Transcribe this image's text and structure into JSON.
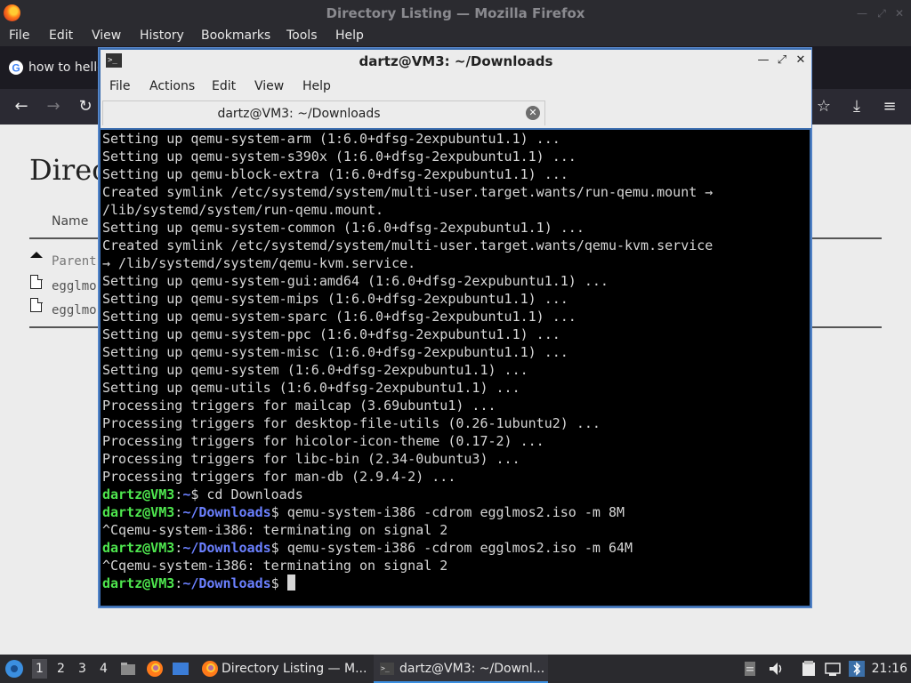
{
  "firefox": {
    "window_title": "Directory Listing — Mozilla Firefox",
    "menu": [
      "File",
      "Edit",
      "View",
      "History",
      "Bookmarks",
      "Tools",
      "Help"
    ],
    "tab_label": "how to hello",
    "page": {
      "heading": "Direc",
      "name_header": "Name",
      "parent_link": "Parent",
      "files": [
        "egglmo",
        "egglmo"
      ]
    }
  },
  "terminal": {
    "window_title": "dartz@VM3: ~/Downloads",
    "menu": [
      "File",
      "Actions",
      "Edit",
      "View",
      "Help"
    ],
    "tab_label": "dartz@VM3: ~/Downloads",
    "output_lines": [
      "Setting up qemu-system-arm (1:6.0+dfsg-2expubuntu1.1) ...",
      "Setting up qemu-system-s390x (1:6.0+dfsg-2expubuntu1.1) ...",
      "Setting up qemu-block-extra (1:6.0+dfsg-2expubuntu1.1) ...",
      "Created symlink /etc/systemd/system/multi-user.target.wants/run-qemu.mount →",
      "/lib/systemd/system/run-qemu.mount.",
      "Setting up qemu-system-common (1:6.0+dfsg-2expubuntu1.1) ...",
      "Created symlink /etc/systemd/system/multi-user.target.wants/qemu-kvm.service",
      "→ /lib/systemd/system/qemu-kvm.service.",
      "Setting up qemu-system-gui:amd64 (1:6.0+dfsg-2expubuntu1.1) ...",
      "Setting up qemu-system-mips (1:6.0+dfsg-2expubuntu1.1) ...",
      "Setting up qemu-system-sparc (1:6.0+dfsg-2expubuntu1.1) ...",
      "Setting up qemu-system-ppc (1:6.0+dfsg-2expubuntu1.1) ...",
      "Setting up qemu-system-misc (1:6.0+dfsg-2expubuntu1.1) ...",
      "Setting up qemu-system (1:6.0+dfsg-2expubuntu1.1) ...",
      "Setting up qemu-utils (1:6.0+dfsg-2expubuntu1.1) ...",
      "Processing triggers for mailcap (3.69ubuntu1) ...",
      "Processing triggers for desktop-file-utils (0.26-1ubuntu2) ...",
      "Processing triggers for hicolor-icon-theme (0.17-2) ...",
      "Processing triggers for libc-bin (2.34-0ubuntu3) ...",
      "Processing triggers for man-db (2.9.4-2) ..."
    ],
    "session": [
      {
        "user": "dartz@VM3",
        "sep": ":",
        "dir": "~",
        "sym": "$ ",
        "cmd": "cd Downloads"
      },
      {
        "user": "dartz@VM3",
        "sep": ":",
        "dir": "~/Downloads",
        "sym": "$ ",
        "cmd": "qemu-system-i386 -cdrom egglmos2.iso -m 8M"
      },
      {
        "output": "^Cqemu-system-i386: terminating on signal 2"
      },
      {
        "user": "dartz@VM3",
        "sep": ":",
        "dir": "~/Downloads",
        "sym": "$ ",
        "cmd": "qemu-system-i386 -cdrom egglmos2.iso -m 64M"
      },
      {
        "output": "^Cqemu-system-i386: terminating on signal 2"
      },
      {
        "user": "dartz@VM3",
        "sep": ":",
        "dir": "~/Downloads",
        "sym": "$ ",
        "cmd": ""
      }
    ]
  },
  "taskbar": {
    "workspaces": [
      "1",
      "2",
      "3",
      "4"
    ],
    "active_workspace": "1",
    "tasks": [
      "Directory Listing — M...",
      "dartz@VM3: ~/Downl..."
    ],
    "clock": "21:16"
  },
  "colors": {
    "prompt_user": "#4ee64e",
    "prompt_dir": "#6b80ff",
    "terminal_bg": "#000000",
    "terminal_border": "#3d6fb1"
  }
}
